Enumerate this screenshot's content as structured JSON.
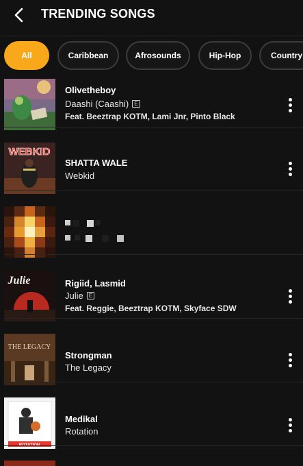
{
  "header": {
    "title": "TRENDING SONGS"
  },
  "filters": [
    {
      "label": "All",
      "active": true
    },
    {
      "label": "Caribbean",
      "active": false
    },
    {
      "label": "Afrosounds",
      "active": false
    },
    {
      "label": "Hip-Hop",
      "active": false
    },
    {
      "label": "Country",
      "active": false
    }
  ],
  "songs": [
    {
      "artist": "Olivetheboy",
      "title": "Daashi (Caashi)",
      "explicit": true,
      "explicit_label": "E",
      "featuring": "Feat. Beeztrap KOTM, Lami Jnr, Pinto Black"
    },
    {
      "artist": "SHATTA WALE",
      "title": "Webkid",
      "explicit": false,
      "featuring": "",
      "cover_text": "WEBKID"
    },
    {
      "artist": "",
      "title": "",
      "explicit": false,
      "featuring": "",
      "redacted": true
    },
    {
      "artist": "Rigiid, Lasmid",
      "title": "Julie",
      "explicit": true,
      "explicit_label": "E",
      "featuring": "Feat. Reggie, Beeztrap KOTM, Skyface SDW",
      "cover_text": "Julie"
    },
    {
      "artist": "Strongman",
      "title": "The Legacy",
      "explicit": false,
      "featuring": "",
      "cover_text": "THE LEGACY"
    },
    {
      "artist": "Medikal",
      "title": "Rotation",
      "explicit": false,
      "featuring": "",
      "cover_text": "ROTATION"
    }
  ],
  "colors": {
    "accent": "#f9a81c",
    "background": "#121212"
  }
}
